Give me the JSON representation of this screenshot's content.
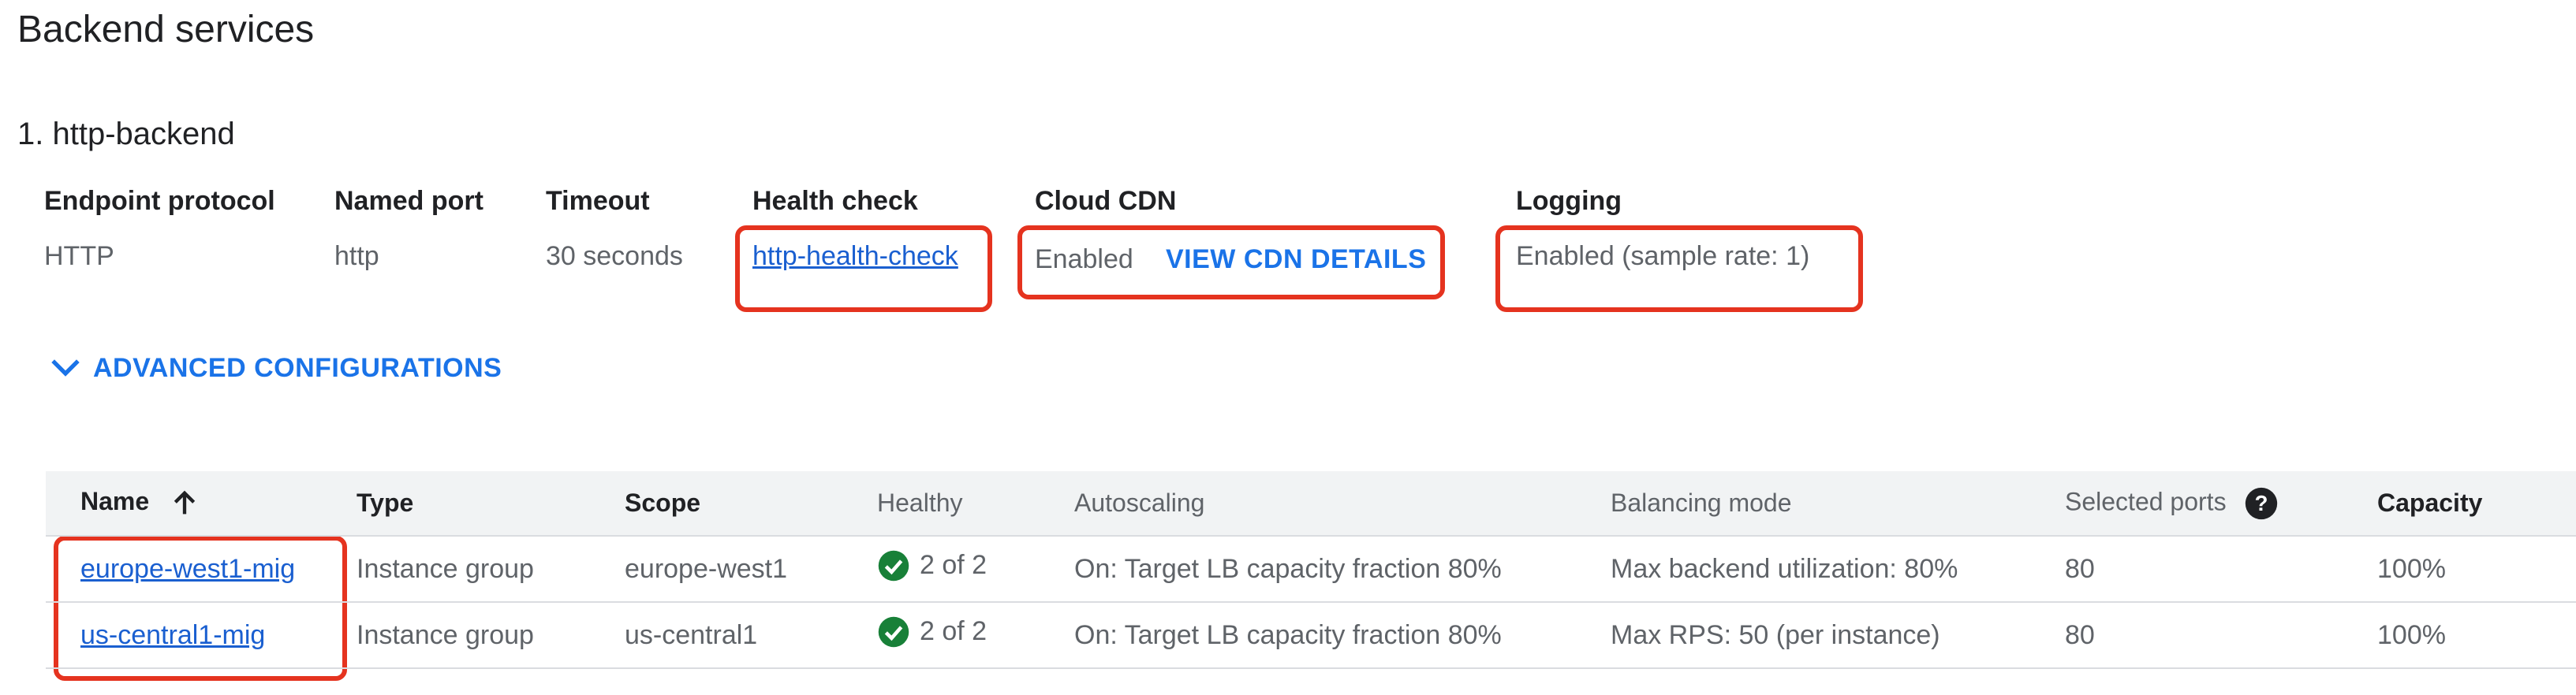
{
  "page": {
    "title": "Backend services",
    "backend_title": "1. http-backend"
  },
  "details": {
    "endpoint_protocol_label": "Endpoint protocol",
    "endpoint_protocol_value": "HTTP",
    "named_port_label": "Named port",
    "named_port_value": "http",
    "timeout_label": "Timeout",
    "timeout_value": "30 seconds",
    "health_check_label": "Health check",
    "health_check_value": "http-health-check",
    "cloud_cdn_label": "Cloud CDN",
    "cloud_cdn_value": "Enabled",
    "cloud_cdn_action": "VIEW CDN DETAILS",
    "logging_label": "Logging",
    "logging_value": "Enabled (sample rate: 1)"
  },
  "advanced": {
    "label": "ADVANCED CONFIGURATIONS"
  },
  "table": {
    "headers": {
      "name": "Name",
      "type": "Type",
      "scope": "Scope",
      "healthy": "Healthy",
      "autoscaling": "Autoscaling",
      "balancing_mode": "Balancing mode",
      "selected_ports": "Selected ports",
      "capacity": "Capacity"
    },
    "rows": [
      {
        "name": "europe-west1-mig",
        "type": "Instance group",
        "scope": "europe-west1",
        "healthy": "2 of 2",
        "autoscaling": "On: Target LB capacity fraction 80%",
        "balancing_mode": "Max backend utilization: 80%",
        "selected_ports": "80",
        "capacity": "100%"
      },
      {
        "name": "us-central1-mig",
        "type": "Instance group",
        "scope": "us-central1",
        "healthy": "2 of 2",
        "autoscaling": "On: Target LB capacity fraction 80%",
        "balancing_mode": "Max RPS: 50 (per instance)",
        "selected_ports": "80",
        "capacity": "100%"
      }
    ]
  },
  "colors": {
    "link": "#1a5fd0",
    "accent": "#1a73e8",
    "healthy": "#188038",
    "highlight": "#e5331f"
  },
  "icons": {
    "sort": "arrow-up-icon",
    "expand": "chevron-down-icon",
    "help": "help-circle-icon",
    "healthy": "check-circle-icon"
  }
}
